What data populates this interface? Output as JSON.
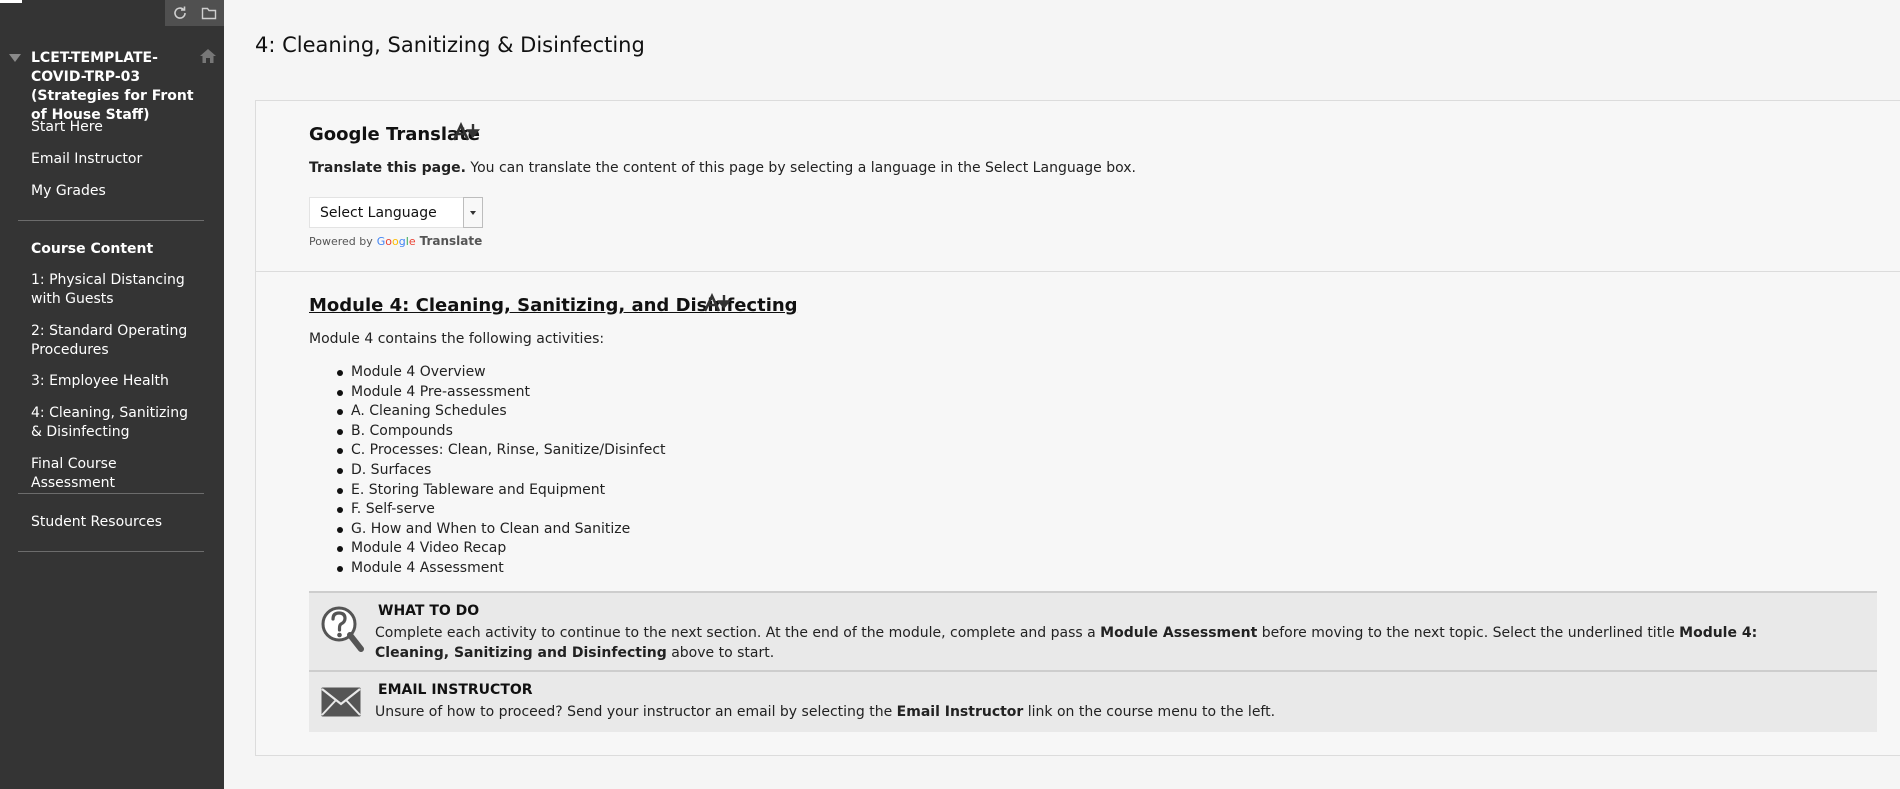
{
  "sidebar": {
    "course_title": "LCET-TEMPLATE-COVID-TRP-03 (Strategies for Front of House Staff)",
    "links": {
      "start_here": "Start Here",
      "email_instructor": "Email Instructor",
      "my_grades": "My Grades"
    },
    "course_content_heading": "Course Content",
    "content_items": {
      "m1": "1: Physical Distancing with Guests",
      "m2": "2: Standard Operating Procedures",
      "m3": "3: Employee Health",
      "m4": "4: Cleaning, Sanitizing & Disinfecting",
      "final": "Final Course Assessment"
    },
    "student_resources": "Student Resources"
  },
  "page": {
    "title": "4: Cleaning, Sanitizing & Disinfecting"
  },
  "google_translate": {
    "heading": "Google Translate",
    "desc_bold": "Translate this page.",
    "desc_rest": " You can translate the content of this page by selecting a language in the Select Language box.",
    "select_value": "Select Language",
    "powered_by": "Powered by",
    "google_letters": [
      "G",
      "o",
      "o",
      "g",
      "l",
      "e"
    ],
    "translate_label": "Translate"
  },
  "module": {
    "title": "Module 4: Cleaning, Sanitizing, and Disinfecting",
    "intro": "Module 4 contains the following activities:",
    "activities": [
      "Module 4 Overview",
      "Module 4 Pre-assessment",
      "A. Cleaning Schedules",
      "B. Compounds",
      "C. Processes: Clean, Rinse, Sanitize/Disinfect",
      "D. Surfaces",
      "E. Storing Tableware and Equipment",
      "F. Self-serve",
      "G. How and When to Clean and Sanitize",
      "Module 4 Video Recap",
      "Module 4 Assessment"
    ]
  },
  "what_to_do": {
    "icon": "question-magnifier-icon",
    "heading": "WHAT TO DO",
    "t1": "Complete each activity to continue to the next section. At the end of the module, complete and pass a ",
    "b1": "Module Assessment",
    "t2": " before moving to the next topic. Select the underlined title ",
    "b2": "Module 4: Cleaning, Sanitizing and Disinfecting",
    "t3": " above to start."
  },
  "email_instructor_box": {
    "icon": "envelope-icon",
    "heading": "EMAIL INSTRUCTOR",
    "t1": "Unsure of how to proceed? Send your instructor an email by selecting the ",
    "b1": "Email Instructor",
    "t2": " link on the course menu to the left."
  }
}
